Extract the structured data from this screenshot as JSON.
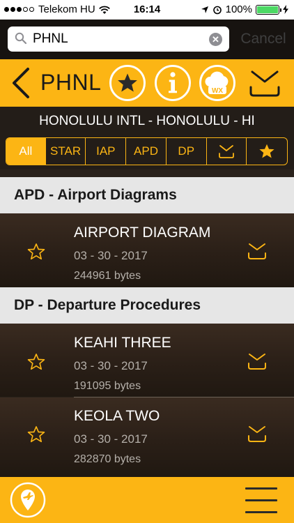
{
  "status_bar": {
    "carrier": "Telekom HU",
    "time": "16:14",
    "battery": "100%",
    "battery_level": 1.0
  },
  "search": {
    "query": "PHNL",
    "placeholder": "",
    "cancel_label": "Cancel"
  },
  "header": {
    "title": "PHNL",
    "wx_label": "WX"
  },
  "airport": {
    "name": "HONOLULU INTL - HONOLULU - HI"
  },
  "filters": [
    {
      "label": "All",
      "active": true
    },
    {
      "label": "STAR",
      "active": false
    },
    {
      "label": "IAP",
      "active": false
    },
    {
      "label": "APD",
      "active": false
    },
    {
      "label": "DP",
      "active": false
    }
  ],
  "sections": [
    {
      "title": "APD - Airport Diagrams",
      "items": [
        {
          "name": "AIRPORT DIAGRAM",
          "date": "03 - 30 - 2017",
          "size": "244961 bytes"
        }
      ]
    },
    {
      "title": "DP - Departure Procedures",
      "items": [
        {
          "name": "KEAHI THREE",
          "date": "03 - 30 - 2017",
          "size": "191095 bytes"
        },
        {
          "name": "KEOLA TWO",
          "date": "03 - 30 - 2017",
          "size": "282870 bytes"
        }
      ]
    }
  ],
  "icons": {
    "accent_color": "#fcb514",
    "back": "chevron-left-icon",
    "favorite": "star-icon",
    "info": "info-icon",
    "weather": "weather-cloud-icon",
    "download": "download-tray-icon",
    "locate": "airport-location-icon",
    "menu": "hamburger-menu-icon"
  }
}
